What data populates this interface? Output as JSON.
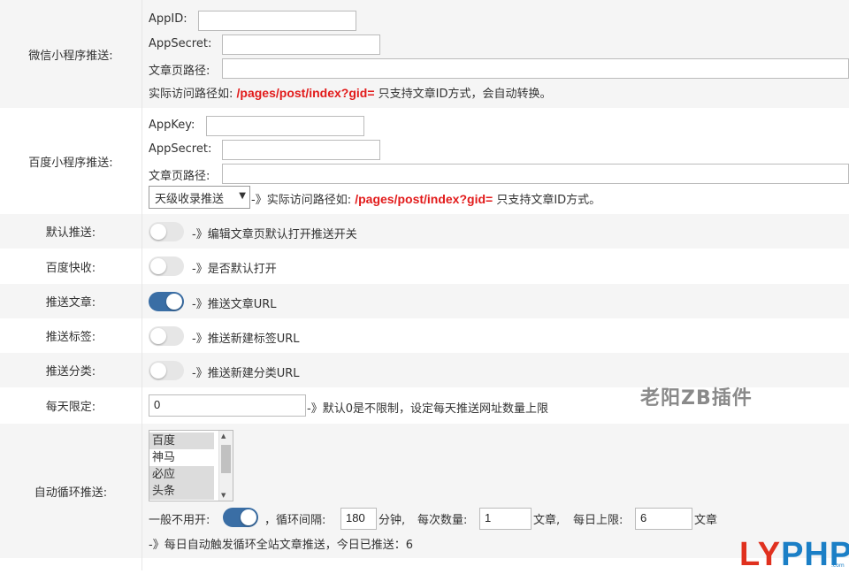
{
  "wechat": {
    "label": "微信小程序推送:",
    "appid_label": "AppID:",
    "appid_value": "",
    "appsecret_label": "AppSecret:",
    "appsecret_value": "",
    "path_label": "文章页路径:",
    "path_value": "",
    "hint_prefix": "实际访问路径如:",
    "hint_path": "/pages/post/index?gid=",
    "hint_suffix": "只支持文章ID方式，会自动转换。"
  },
  "baidu": {
    "label": "百度小程序推送:",
    "appkey_label": "AppKey:",
    "appkey_value": "",
    "appsecret_label": "AppSecret:",
    "appsecret_value": "",
    "path_label": "文章页路径:",
    "path_value": "",
    "select_value": "天级收录推送",
    "hint_prefix": "-》实际访问路径如:",
    "hint_path": "/pages/post/index?gid=",
    "hint_suffix": "只支持文章ID方式。"
  },
  "toggles": [
    {
      "label": "默认推送:",
      "on": false,
      "desc": "-》编辑文章页默认打开推送开关"
    },
    {
      "label": "百度快收:",
      "on": false,
      "desc": "-》是否默认打开"
    },
    {
      "label": "推送文章:",
      "on": true,
      "desc": "-》推送文章URL"
    },
    {
      "label": "推送标签:",
      "on": false,
      "desc": "-》推送新建标签URL"
    },
    {
      "label": "推送分类:",
      "on": false,
      "desc": "-》推送新建分类URL"
    }
  ],
  "daily_limit": {
    "label": "每天限定:",
    "value": "0",
    "desc": "-》默认0是不限制，设定每天推送网址数量上限"
  },
  "auto_loop": {
    "label": "自动循环推送:",
    "engines": [
      {
        "name": "百度",
        "selected": true
      },
      {
        "name": "神马",
        "selected": false
      },
      {
        "name": "必应",
        "selected": true
      },
      {
        "name": "头条",
        "selected": true
      }
    ],
    "enable_label": "一般不用开:",
    "enabled": true,
    "interval_label": "，循环间隔:",
    "interval_value": "180",
    "interval_unit": "分钟,",
    "batch_label": "每次数量:",
    "batch_value": "1",
    "batch_unit": "文章,",
    "daily_label": "每日上限:",
    "daily_value": "6",
    "daily_unit": "文章",
    "footer": "-》每日自动触发循环全站文章推送，今日已推送：6"
  },
  "watermark": "老阳ZB插件",
  "logo": {
    "part1": "LY",
    "part2": "PHP",
    "sub": ".com"
  },
  "colors": {
    "accent": "#3a6ea5",
    "highlight": "#e21b1b"
  }
}
